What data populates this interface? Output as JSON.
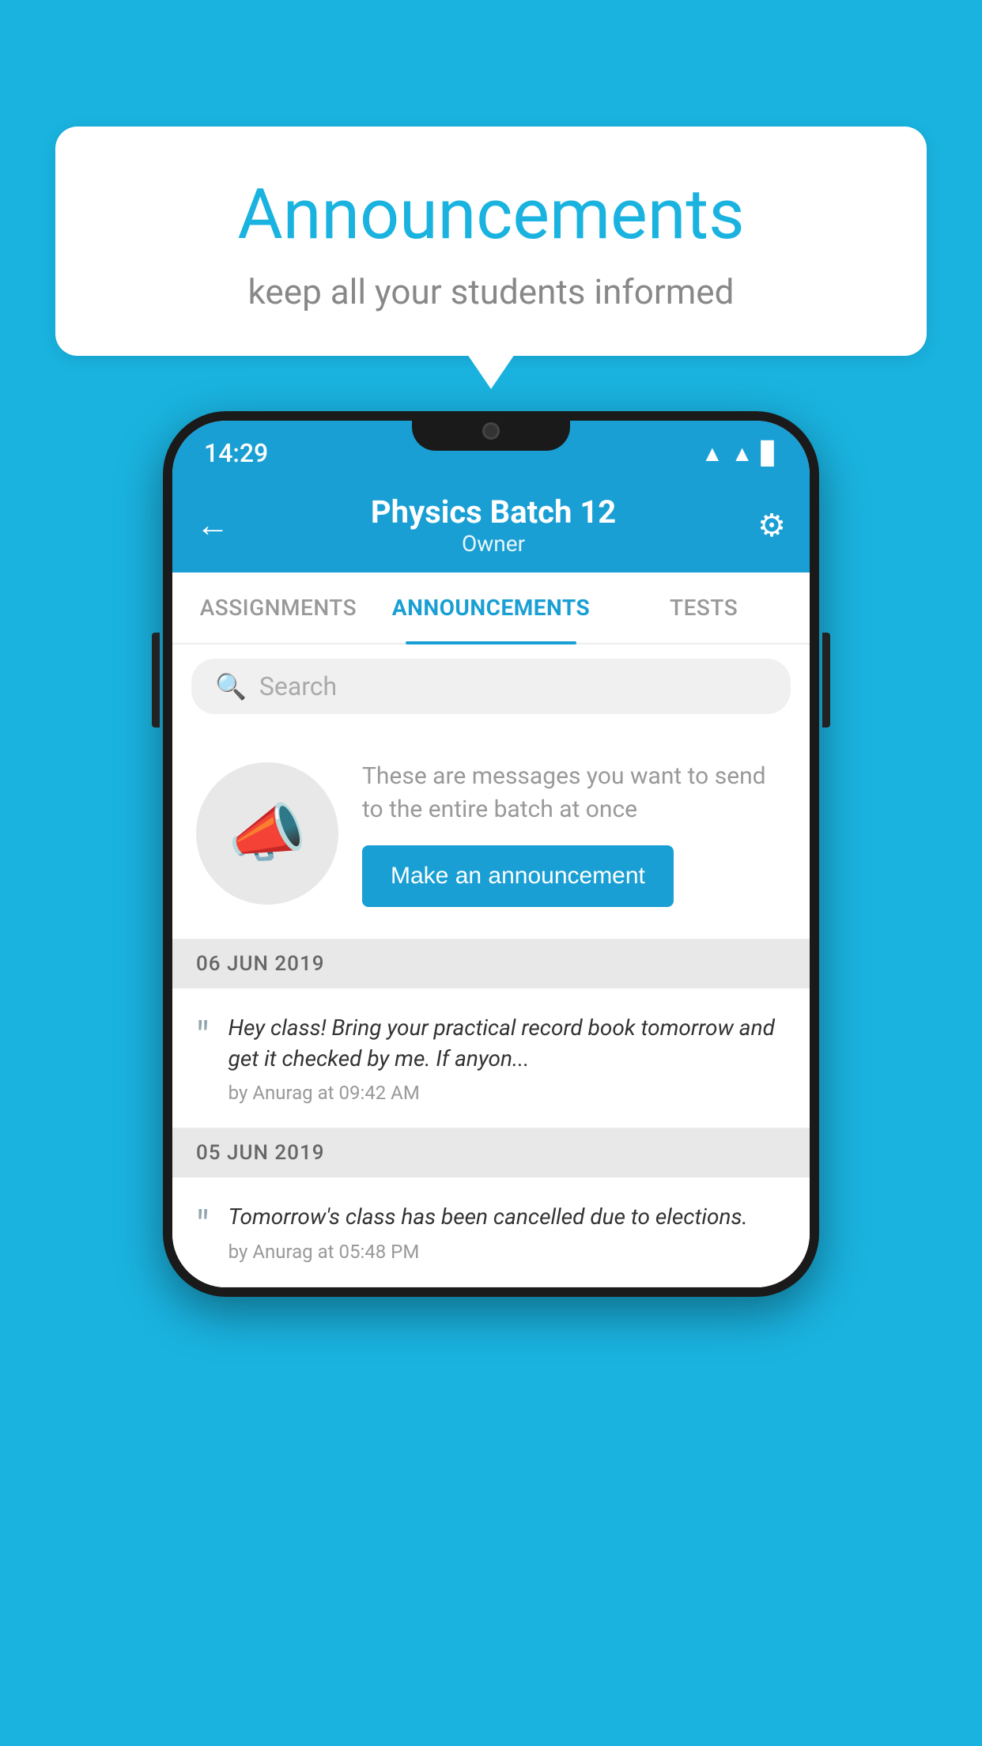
{
  "page": {
    "background_color": "#1ab3e0"
  },
  "speech_bubble": {
    "title": "Announcements",
    "subtitle": "keep all your students informed"
  },
  "phone": {
    "status_bar": {
      "time": "14:29"
    },
    "app_bar": {
      "title": "Physics Batch 12",
      "subtitle": "Owner",
      "back_label": "←",
      "settings_label": "⚙"
    },
    "tabs": [
      {
        "label": "ASSIGNMENTS",
        "active": false
      },
      {
        "label": "ANNOUNCEMENTS",
        "active": true
      },
      {
        "label": "TESTS",
        "active": false
      }
    ],
    "search": {
      "placeholder": "Search"
    },
    "announcement_cta": {
      "description": "These are messages you want to send to the entire batch at once",
      "button_label": "Make an announcement"
    },
    "announcements": [
      {
        "date": "06  JUN  2019",
        "message": "Hey class! Bring your practical record book tomorrow and get it checked by me. If anyon...",
        "author": "by Anurag at 09:42 AM"
      },
      {
        "date": "05  JUN  2019",
        "message": "Tomorrow's class has been cancelled due to elections.",
        "author": "by Anurag at 05:48 PM"
      }
    ]
  }
}
